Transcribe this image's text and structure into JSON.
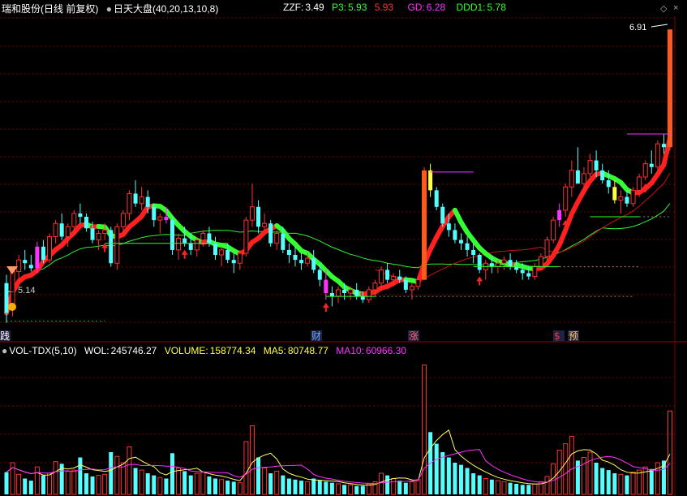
{
  "header": {
    "stock_name": "瑞和股份",
    "period": "(日线 前复权)",
    "indicator": "日天大盘",
    "params": "(40,20,13,10,8)",
    "zzf_label": "ZZF:",
    "zzf_value": "3.49",
    "p3_label": "P3:",
    "p3_value": "5.93",
    "p3_value2": "5.93",
    "gd_label": "GD:",
    "gd_value": "6.28",
    "ddd1_label": "DDD1:",
    "ddd1_value": "5.78"
  },
  "volume_header": {
    "name": "VOL-TDX(5,10)",
    "wol_label": "WOL:",
    "wol_value": "245746.27",
    "volume_label": "VOLUME:",
    "volume_value": "158774.34",
    "ma5_label": "MA5:",
    "ma5_value": "80748.77",
    "ma10_label": "MA10:",
    "ma10_value": "60966.30"
  },
  "annotations": {
    "high_label": "6.91",
    "low_label": "5.14",
    "markers": [
      {
        "text": "践",
        "color": "#ffffff"
      },
      {
        "text": "财",
        "color": "#66aaff"
      },
      {
        "text": "涨",
        "color": "#ff6666"
      },
      {
        "text": "$",
        "color": "#ff3333"
      },
      {
        "text": "预",
        "color": "#ffcc66"
      }
    ]
  },
  "colors": {
    "background": "#000000",
    "grid": "#7a0000",
    "up": "#ff3232",
    "down": "#54ffff",
    "magenta": "#ff33ff",
    "yellow": "#ffff44",
    "green_band": "#33ff33",
    "ma_green": "#33ee33",
    "ma_red": "#ff2020",
    "vol_ma5": "#ffff66",
    "vol_ma10": "#ff33ff"
  },
  "chart_data": [
    {
      "type": "candlestick",
      "title": "日天大盘",
      "y_range": [
        5.08,
        6.98
      ],
      "candles": [
        [
          5.38,
          5.43,
          5.14,
          5.2
        ],
        [
          5.22,
          5.48,
          5.18,
          5.45
        ],
        [
          5.45,
          5.55,
          5.4,
          5.52
        ],
        [
          5.52,
          5.58,
          5.46,
          5.5
        ],
        [
          5.49,
          5.55,
          5.45,
          5.47
        ],
        [
          5.47,
          5.63,
          5.44,
          5.6
        ],
        [
          5.6,
          5.64,
          5.5,
          5.52
        ],
        [
          5.52,
          5.68,
          5.5,
          5.66
        ],
        [
          5.66,
          5.76,
          5.62,
          5.74
        ],
        [
          5.74,
          5.8,
          5.64,
          5.66
        ],
        [
          5.66,
          5.74,
          5.6,
          5.72
        ],
        [
          5.72,
          5.82,
          5.68,
          5.8
        ],
        [
          5.8,
          5.86,
          5.74,
          5.78
        ],
        [
          5.78,
          5.8,
          5.69,
          5.71
        ],
        [
          5.71,
          5.75,
          5.62,
          5.64
        ],
        [
          5.64,
          5.7,
          5.58,
          5.68
        ],
        [
          5.68,
          5.74,
          5.64,
          5.7
        ],
        [
          5.7,
          5.72,
          5.48,
          5.5
        ],
        [
          5.5,
          5.74,
          5.46,
          5.72
        ],
        [
          5.72,
          5.82,
          5.68,
          5.8
        ],
        [
          5.8,
          5.94,
          5.76,
          5.92
        ],
        [
          5.92,
          6.0,
          5.84,
          5.86
        ],
        [
          5.86,
          5.96,
          5.82,
          5.9
        ],
        [
          5.9,
          5.94,
          5.8,
          5.84
        ],
        [
          5.84,
          5.86,
          5.72,
          5.76
        ],
        [
          5.76,
          5.8,
          5.68,
          5.78
        ],
        [
          5.78,
          5.84,
          5.74,
          5.76
        ],
        [
          5.76,
          5.78,
          5.55,
          5.58
        ],
        [
          5.58,
          5.68,
          5.52,
          5.65
        ],
        [
          5.65,
          5.72,
          5.6,
          5.62
        ],
        [
          5.62,
          5.68,
          5.55,
          5.58
        ],
        [
          5.58,
          5.66,
          5.54,
          5.64
        ],
        [
          5.64,
          5.7,
          5.6,
          5.68
        ],
        [
          5.68,
          5.72,
          5.6,
          5.62
        ],
        [
          5.62,
          5.66,
          5.52,
          5.55
        ],
        [
          5.55,
          5.6,
          5.48,
          5.58
        ],
        [
          5.58,
          5.62,
          5.5,
          5.52
        ],
        [
          5.52,
          5.56,
          5.44,
          5.5
        ],
        [
          5.5,
          5.58,
          5.46,
          5.56
        ],
        [
          5.56,
          5.78,
          5.54,
          5.76
        ],
        [
          5.76,
          5.98,
          5.72,
          5.84
        ],
        [
          5.84,
          5.88,
          5.68,
          5.72
        ],
        [
          5.72,
          5.8,
          5.7,
          5.74
        ],
        [
          5.74,
          5.76,
          5.6,
          5.62
        ],
        [
          5.62,
          5.7,
          5.58,
          5.68
        ],
        [
          5.68,
          5.72,
          5.56,
          5.58
        ],
        [
          5.58,
          5.62,
          5.5,
          5.55
        ],
        [
          5.55,
          5.6,
          5.48,
          5.52
        ],
        [
          5.52,
          5.56,
          5.46,
          5.5
        ],
        [
          5.5,
          5.56,
          5.48,
          5.53
        ],
        [
          5.53,
          5.58,
          5.44,
          5.46
        ],
        [
          5.46,
          5.5,
          5.36,
          5.4
        ],
        [
          5.4,
          5.46,
          5.28,
          5.32
        ],
        [
          5.32,
          5.36,
          5.24,
          5.3
        ],
        [
          5.3,
          5.36,
          5.26,
          5.34
        ],
        [
          5.34,
          5.38,
          5.28,
          5.32
        ],
        [
          5.32,
          5.36,
          5.28,
          5.34
        ],
        [
          5.34,
          5.38,
          5.28,
          5.3
        ],
        [
          5.3,
          5.33,
          5.26,
          5.28
        ],
        [
          5.28,
          5.36,
          5.26,
          5.34
        ],
        [
          5.34,
          5.4,
          5.3,
          5.38
        ],
        [
          5.38,
          5.48,
          5.34,
          5.46
        ],
        [
          5.46,
          5.5,
          5.38,
          5.4
        ],
        [
          5.4,
          5.44,
          5.36,
          5.42
        ],
        [
          5.42,
          5.46,
          5.38,
          5.4
        ],
        [
          5.4,
          5.42,
          5.32,
          5.34
        ],
        [
          5.34,
          5.38,
          5.28,
          5.36
        ],
        [
          5.36,
          5.42,
          5.34,
          5.4
        ],
        [
          5.4,
          6.08,
          5.4,
          6.06
        ],
        [
          6.06,
          6.1,
          5.9,
          5.94
        ],
        [
          5.94,
          5.96,
          5.82,
          5.84
        ],
        [
          5.84,
          5.86,
          5.72,
          5.74
        ],
        [
          5.74,
          5.8,
          5.66,
          5.7
        ],
        [
          5.7,
          5.74,
          5.62,
          5.64
        ],
        [
          5.64,
          5.68,
          5.58,
          5.62
        ],
        [
          5.62,
          5.66,
          5.54,
          5.58
        ],
        [
          5.58,
          5.62,
          5.5,
          5.55
        ],
        [
          5.55,
          5.56,
          5.44,
          5.46
        ],
        [
          5.46,
          5.52,
          5.4,
          5.5
        ],
        [
          5.5,
          5.54,
          5.44,
          5.48
        ],
        [
          5.48,
          5.52,
          5.44,
          5.5
        ],
        [
          5.5,
          5.54,
          5.46,
          5.52
        ],
        [
          5.52,
          5.56,
          5.46,
          5.48
        ],
        [
          5.48,
          5.52,
          5.44,
          5.46
        ],
        [
          5.46,
          5.5,
          5.4,
          5.44
        ],
        [
          5.44,
          5.48,
          5.4,
          5.42
        ],
        [
          5.42,
          5.5,
          5.4,
          5.48
        ],
        [
          5.48,
          5.56,
          5.46,
          5.54
        ],
        [
          5.54,
          5.66,
          5.52,
          5.64
        ],
        [
          5.64,
          5.78,
          5.62,
          5.76
        ],
        [
          5.76,
          5.86,
          5.72,
          5.82
        ],
        [
          5.82,
          5.98,
          5.78,
          5.96
        ],
        [
          5.96,
          6.12,
          5.9,
          6.06
        ],
        [
          6.06,
          6.2,
          6.0,
          5.98
        ],
        [
          5.98,
          6.08,
          5.92,
          6.04
        ],
        [
          6.04,
          6.16,
          6.02,
          6.12
        ],
        [
          6.12,
          6.18,
          6.02,
          6.06
        ],
        [
          6.06,
          6.1,
          5.98,
          6.0
        ],
        [
          6.0,
          6.06,
          5.92,
          5.96
        ],
        [
          5.96,
          6.0,
          5.86,
          5.88
        ],
        [
          5.88,
          5.94,
          5.8,
          5.9
        ],
        [
          5.9,
          5.94,
          5.84,
          5.86
        ],
        [
          5.86,
          5.96,
          5.84,
          5.94
        ],
        [
          5.94,
          6.04,
          5.9,
          6.02
        ],
        [
          6.02,
          6.12,
          6.0,
          6.1
        ],
        [
          6.1,
          6.18,
          6.04,
          6.08
        ],
        [
          6.08,
          6.24,
          6.06,
          6.22
        ],
        [
          6.22,
          6.28,
          6.16,
          6.2
        ],
        [
          6.2,
          6.91,
          6.18,
          6.91
        ]
      ]
    },
    {
      "type": "bar",
      "title": "VOL-TDX(5,10)",
      "y_max": 260000,
      "values": [
        42000,
        60000,
        38000,
        30000,
        26000,
        52000,
        36000,
        40000,
        62000,
        58000,
        44000,
        46000,
        70000,
        40000,
        34000,
        36000,
        38000,
        80000,
        72000,
        60000,
        90000,
        50000,
        46000,
        40000,
        36000,
        32000,
        30000,
        78000,
        50000,
        44000,
        36000,
        40000,
        42000,
        34000,
        30000,
        28000,
        26000,
        24000,
        22000,
        100000,
        130000,
        70000,
        50000,
        40000,
        44000,
        36000,
        30000,
        28000,
        26000,
        24000,
        30000,
        26000,
        24000,
        22000,
        20000,
        18000,
        18000,
        16000,
        16000,
        20000,
        24000,
        40000,
        36000,
        30000,
        26000,
        22000,
        24000,
        28000,
        245000,
        118000,
        96000,
        80000,
        70000,
        60000,
        56000,
        50000,
        40000,
        36000,
        30000,
        28000,
        26000,
        24000,
        22000,
        20000,
        18000,
        18000,
        20000,
        24000,
        34000,
        58000,
        84000,
        96000,
        110000,
        64000,
        70000,
        80000,
        60000,
        50000,
        46000,
        40000,
        38000,
        36000,
        42000,
        46000,
        52000,
        48000,
        60000,
        64000,
        158000
      ]
    }
  ]
}
